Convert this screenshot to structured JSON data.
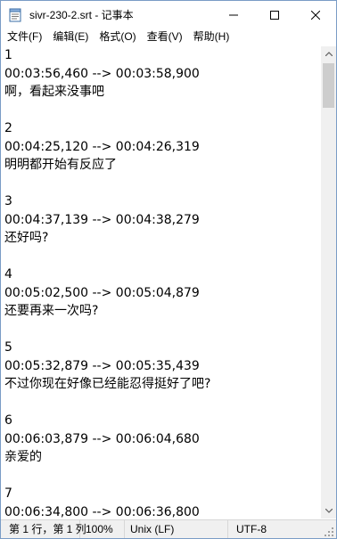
{
  "titlebar": {
    "title": "sivr-230-2.srt - 记事本"
  },
  "menu": [
    "文件(F)",
    "编辑(E)",
    "格式(O)",
    "查看(V)",
    "帮助(H)"
  ],
  "editor": {
    "lines": [
      "1",
      "00:03:56,460 --> 00:03:58,900",
      "啊，看起来没事吧",
      "",
      "2",
      "00:04:25,120 --> 00:04:26,319",
      "明明都开始有反应了",
      "",
      "3",
      "00:04:37,139 --> 00:04:38,279",
      "还好吗?",
      "",
      "4",
      "00:05:02,500 --> 00:05:04,879",
      "还要再来一次吗?",
      "",
      "5",
      "00:05:32,879 --> 00:05:35,439",
      "不过你现在好像已经能忍得挺好了吧?",
      "",
      "6",
      "00:06:03,879 --> 00:06:04,680",
      "亲爱的",
      "",
      "7",
      "00:06:34,800 --> 00:06:36,800"
    ]
  },
  "statusbar": {
    "position": "第 1 行，第 1 列",
    "zoom": "100%",
    "line_ending": "Unix (LF)",
    "encoding": "UTF-8"
  },
  "colors": {
    "window_border": "#7a9cc6",
    "statusbar_bg": "#f0f0f0",
    "scrollbar_thumb": "#cdcdcd"
  },
  "icons": {
    "app": "notepad-icon",
    "minimize": "minimize-icon",
    "maximize": "maximize-icon",
    "close": "close-icon"
  }
}
